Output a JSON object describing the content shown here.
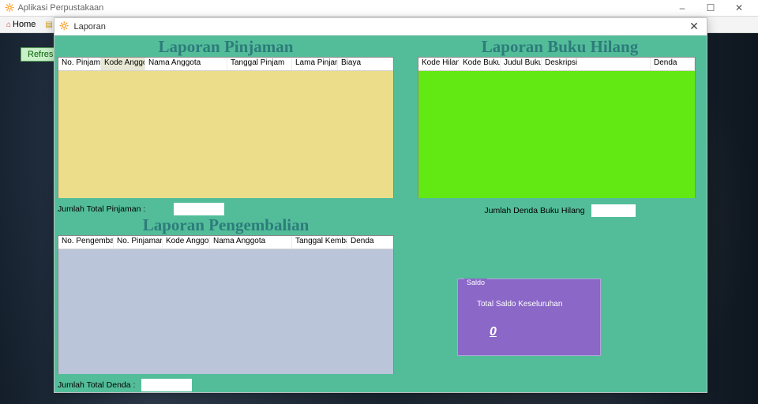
{
  "app_title": "Aplikasi Perpustakaan",
  "outer_toolbar": {
    "home": "Home"
  },
  "refresh_label": "Refresh",
  "child": {
    "title": "Laporan"
  },
  "pinjaman": {
    "title": "Laporan Pinjaman",
    "headers": {
      "no_pinjaman": "No. Pinjaman",
      "kode_anggota": "Kode Anggota",
      "nama_anggota": "Nama Anggota",
      "tanggal_pinjam": "Tanggal Pinjam",
      "lama_pinjam": "Lama Pinjam",
      "biaya": "Biaya"
    },
    "summary_label": "Jumlah Total Pinjaman :",
    "summary_value": ""
  },
  "pengembalian": {
    "title": "Laporan Pengembalian",
    "headers": {
      "no_pengembalian": "No. Pengembalian",
      "no_pinjaman": "No. Pinjaman",
      "kode_anggota": "Kode Anggota",
      "nama_anggota": "Nama Anggota",
      "tanggal_kembali": "Tanggal Kembali",
      "denda": "Denda"
    },
    "summary_label": "Jumlah Total Denda :",
    "summary_value": ""
  },
  "hilang": {
    "title": "Laporan Buku Hilang",
    "headers": {
      "kode_hilang": "Kode Hilang",
      "kode_buku": "Kode Buku",
      "judul_buku": "Judul Buku",
      "deskripsi": "Deskripsi",
      "denda": "Denda"
    },
    "summary_label": "Jumlah Denda Buku Hilang",
    "summary_value": ""
  },
  "saldo": {
    "legend": "Saldo",
    "label": "Total Saldo Keseluruhan",
    "value": "0"
  }
}
